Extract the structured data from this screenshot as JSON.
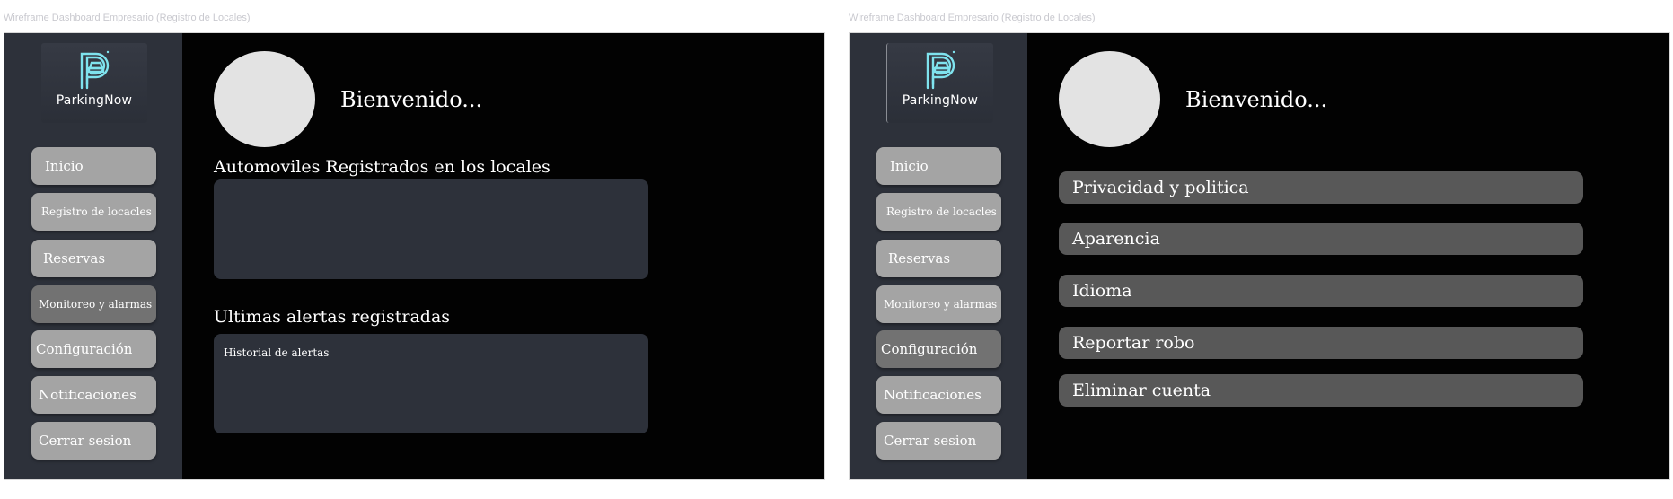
{
  "frames": [
    {
      "label": "Wireframe Dashboard Empresario (Registro de Locales)",
      "logo_text": "ParkingNow",
      "welcome": "Bienvenido...",
      "nav": [
        {
          "label": "Inicio"
        },
        {
          "label": "Registro de locacles"
        },
        {
          "label": "Reservas"
        },
        {
          "label": "Monitoreo y alarmas"
        },
        {
          "label": "Configuración"
        },
        {
          "label": "Notificaciones"
        },
        {
          "label": "Cerrar sesion"
        }
      ],
      "active_nav": "Monitoreo y alarmas",
      "sections": {
        "registered_title": "Automoviles Registrados en los locales",
        "alerts_title": "Ultimas alertas registradas",
        "alerts_panel_text": "Historial de alertas"
      }
    },
    {
      "label": "Wireframe Dashboard Empresario (Registro de Locales)",
      "logo_text": "ParkingNow",
      "welcome": "Bienvenido...",
      "nav": [
        {
          "label": "Inicio"
        },
        {
          "label": "Registro de locacles"
        },
        {
          "label": "Reservas"
        },
        {
          "label": "Monitoreo y alarmas"
        },
        {
          "label": "Configuración"
        },
        {
          "label": "Notificaciones"
        },
        {
          "label": "Cerrar sesion"
        }
      ],
      "active_nav": "Configuración",
      "settings": [
        {
          "label": "Privacidad y politica"
        },
        {
          "label": "Aparencia"
        },
        {
          "label": "Idioma"
        },
        {
          "label": "Reportar robo"
        },
        {
          "label": "Eliminar cuenta"
        }
      ]
    }
  ],
  "colors": {
    "frame_background": "#020202",
    "sidebar": "#2d313a",
    "nav_button": "#a4a4a4",
    "nav_button_active": "#727272",
    "settings_button": "#585858",
    "logo_accent": "#7fe3ee",
    "avatar": "#e3e3e3"
  },
  "icons": {
    "logo": "parking-car-logo-icon",
    "avatar": "user-avatar-placeholder"
  }
}
